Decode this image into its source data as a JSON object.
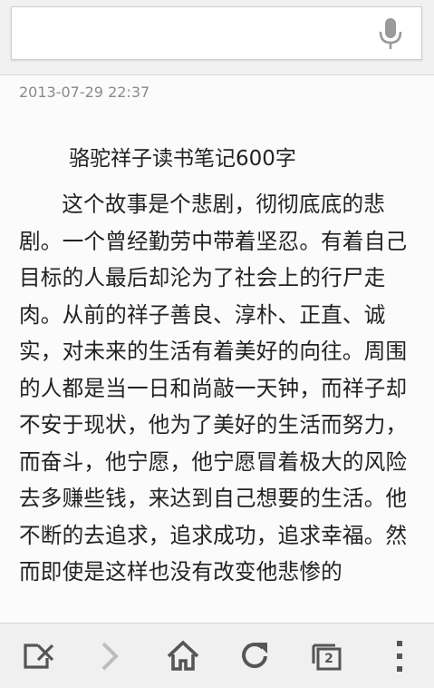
{
  "search": {
    "value": "",
    "placeholder": ""
  },
  "article": {
    "timestamp": "2013-07-29 22:37",
    "title": "骆驼祥子读书笔记600字",
    "body": "这个故事是个悲剧，彻彻底底的悲剧。一个曾经勤劳中带着坚忍。有着自己目标的人最后却沦为了社会上的行尸走肉。从前的祥子善良、淳朴、正直、诚实，对未来的生活有着美好的向往。周围的人都是当一日和尚敲一天钟，而祥子却不安于现状，他为了美好的生活而努力，而奋斗，他宁愿，他宁愿冒着极大的风险去多赚些钱，来达到自己想要的生活。他不断的去追求，追求成功，追求幸福。然而即使是这样也没有改变他悲惨的"
  },
  "toolbar": {
    "tab_count": "2"
  },
  "icons": {
    "mic": "mic-icon",
    "close_page": "close-page-icon",
    "forward": "forward-icon",
    "home": "home-icon",
    "refresh": "refresh-icon",
    "tabs": "tabs-icon",
    "menu": "menu-icon"
  },
  "colors": {
    "icon": "#555555",
    "icon_disabled": "#bdbdbd",
    "mic": "#9a9a9a",
    "timestamp": "#8a8a8a",
    "text": "#222222"
  }
}
